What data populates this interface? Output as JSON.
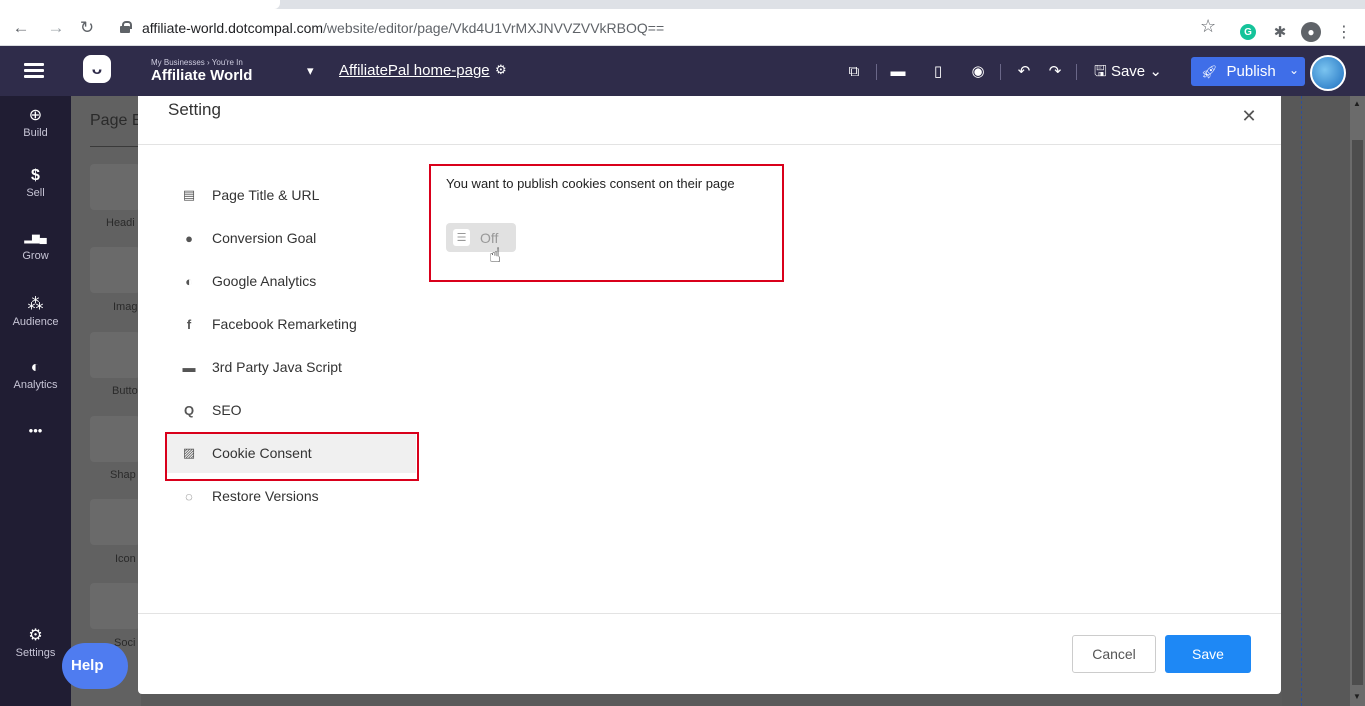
{
  "browser": {
    "url_host": "affiliate-world.dotcompal.com",
    "url_path": "/website/editor/page/Vkd4U1VrMXJNVVZVVkRBOQ==",
    "icons": [
      "back-arrow-icon",
      "forward-arrow-icon",
      "reload-icon",
      "lock-icon",
      "star-icon",
      "grammarly-icon",
      "extensions-icon",
      "profile-icon",
      "kebab-menu-icon"
    ]
  },
  "topbar": {
    "business_caption": "My Businesses › You're In",
    "business_name": "Affiliate World",
    "page_name": "AffiliatePal home-page",
    "save_label": "Save",
    "publish_label": "Publish",
    "accent_color": "#3f6ee8"
  },
  "sidebar": {
    "items": [
      {
        "icon": "⊕",
        "label": "Build"
      },
      {
        "icon": "$",
        "label": "Sell"
      },
      {
        "icon": "▂▆▄",
        "label": "Grow"
      },
      {
        "icon": "⁂",
        "label": "Audience"
      },
      {
        "icon": "◐",
        "label": "Analytics"
      },
      {
        "icon": "•••",
        "label": ""
      }
    ],
    "settings_label": "Settings",
    "help_label": "Help"
  },
  "background_panel": {
    "title": "Page E",
    "tile_labels": [
      "Headi",
      "Imag",
      "Butto",
      "Shap",
      "Icon",
      "Soci"
    ]
  },
  "modal": {
    "title": "Setting",
    "menu": [
      {
        "icon": "page-title-icon",
        "glyph": "▤",
        "label": "Page Title & URL"
      },
      {
        "icon": "conversion-goal-icon",
        "glyph": "●",
        "label": "Conversion Goal"
      },
      {
        "icon": "google-analytics-icon",
        "glyph": "◐",
        "label": "Google Analytics"
      },
      {
        "icon": "facebook-icon",
        "glyph": "f",
        "label": "Facebook Remarketing"
      },
      {
        "icon": "javascript-file-icon",
        "glyph": "▬",
        "label": "3rd Party Java Script"
      },
      {
        "icon": "seo-search-icon",
        "glyph": "Q",
        "label": "SEO"
      },
      {
        "icon": "cookie-consent-icon",
        "glyph": "▨",
        "label": "Cookie Consent"
      },
      {
        "icon": "restore-versions-icon",
        "glyph": "◌",
        "label": "Restore Versions"
      }
    ],
    "active_item": "Cookie Consent",
    "consent_question": "You want to publish cookies consent on their page",
    "toggle_label": "Off",
    "toggle_on": false,
    "cancel_label": "Cancel",
    "save_label": "Save",
    "highlight_color": "#d9001b",
    "save_color": "#1e88f5"
  }
}
